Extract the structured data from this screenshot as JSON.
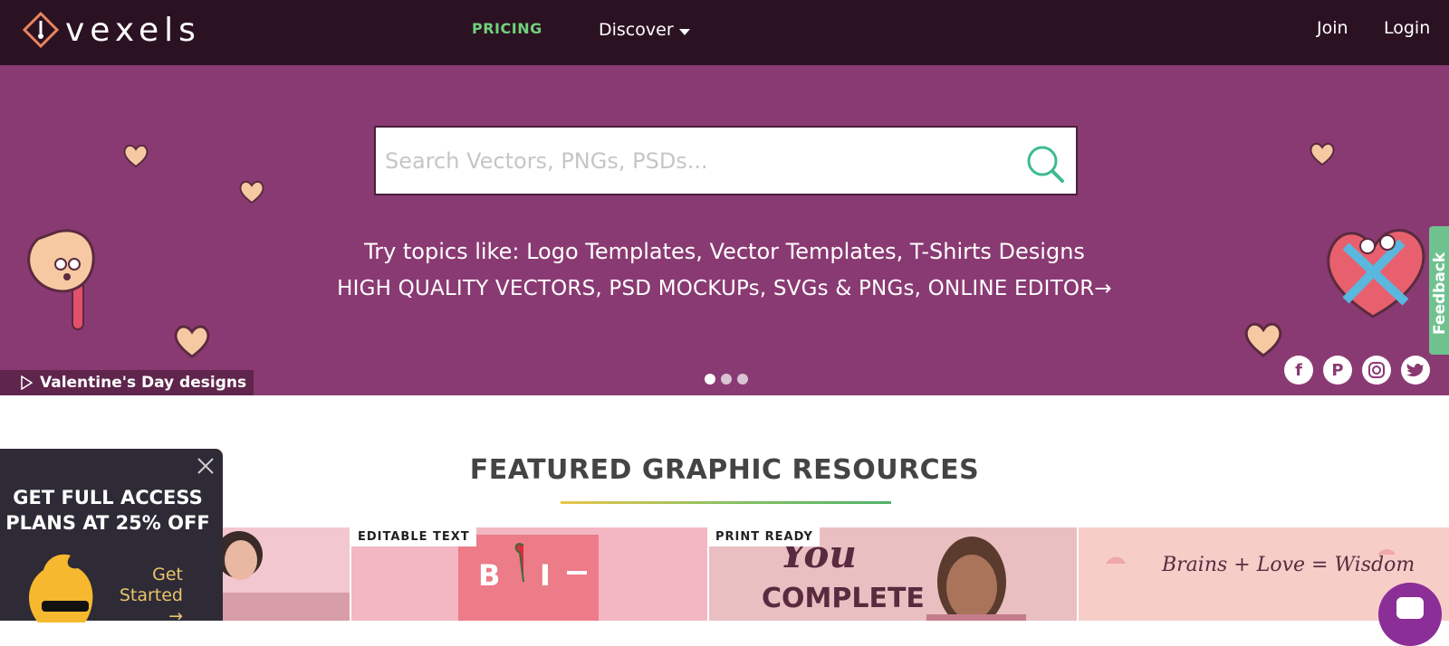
{
  "header": {
    "logo_text": "vexels",
    "nav": {
      "pricing": "PRICING",
      "discover": "Discover",
      "join": "Join",
      "login": "Login"
    }
  },
  "hero": {
    "search_placeholder": "Search Vectors, PNGs, PSDs...",
    "topics_line": "Try topics like: Logo Templates, Vector Templates, T-Shirts Designs",
    "promo_line": "HIGH QUALITY VECTORS, PSD MOCKUPs, SVGs & PNGs, ONLINE EDITOR→",
    "slide_caption": "Valentine's Day designs",
    "slide_count": 3,
    "active_slide": 1,
    "socials": [
      "facebook-icon",
      "pinterest-icon",
      "instagram-icon",
      "twitter-icon"
    ]
  },
  "feedback_tab": {
    "label": "Feedback"
  },
  "featured": {
    "title": "FEATURED GRAPHIC RESOURCES",
    "cards": [
      {
        "label": "",
        "bg": "#f3c7cf"
      },
      {
        "label": "EDITABLE TEXT",
        "bg": "#f2b7c2",
        "art_text": "B I —"
      },
      {
        "label": "PRINT READY",
        "bg": "#eabfc2",
        "art_text": "You COMPLETE"
      },
      {
        "label": "",
        "bg": "#f7cdc8",
        "art_text": "Brains + Love = Wisdom"
      }
    ]
  },
  "promo_popup": {
    "title": "GET FULL ACCESS PLANS AT 25% OFF",
    "cta": "Get Started →"
  },
  "colors": {
    "topbar": "#2b1222",
    "hero": "#8a3a72",
    "accent_green": "#6fd17c",
    "search_icon": "#3dbb8e",
    "promo_bg": "#2e2b36",
    "promo_cta": "#e9c46a"
  }
}
